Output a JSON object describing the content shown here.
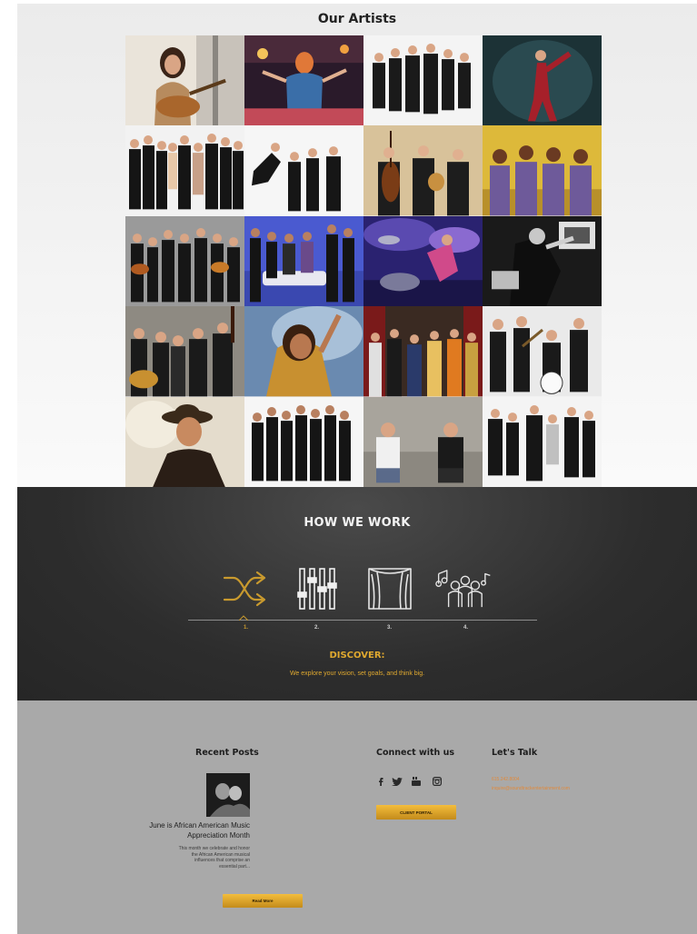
{
  "artists": {
    "title": "Our Artists",
    "tiles": [
      "artist-tile-1",
      "artist-tile-2",
      "artist-tile-3",
      "artist-tile-4",
      "artist-tile-5",
      "artist-tile-6",
      "artist-tile-7",
      "artist-tile-8",
      "artist-tile-9",
      "artist-tile-10",
      "artist-tile-11",
      "artist-tile-12",
      "artist-tile-13",
      "artist-tile-14",
      "artist-tile-15",
      "artist-tile-16",
      "artist-tile-17",
      "artist-tile-18",
      "artist-tile-19",
      "artist-tile-20"
    ]
  },
  "how_we_work": {
    "title": "HOW WE WORK",
    "steps": [
      {
        "number": "1.",
        "icon": "shuffle-icon"
      },
      {
        "number": "2.",
        "icon": "mixer-sliders-icon"
      },
      {
        "number": "3.",
        "icon": "stage-curtain-icon"
      },
      {
        "number": "4.",
        "icon": "audience-music-icon"
      }
    ],
    "active_step_title": "DISCOVER:",
    "active_step_text": "We explore your vision, set goals, and think big."
  },
  "footer": {
    "recent_posts": {
      "heading": "Recent Posts",
      "post_title": "June is African American Music Appreciation Month",
      "post_excerpt": "This month we celebrate and honor the African American musical influences that comprise an essential part...",
      "read_more": "Read More"
    },
    "connect": {
      "heading": "Connect with us",
      "icons": [
        "facebook-icon",
        "twitter-icon",
        "youtube-icon",
        "instagram-icon"
      ],
      "portal_button": "CLIENT PORTAL"
    },
    "talk": {
      "heading": "Let's Talk",
      "phone": "615.242.8004",
      "email": "inquire@soundtrackentertainment.com"
    }
  },
  "colors": {
    "accent": "#e0a92f",
    "dark_band": "#2d2d2d",
    "footer_bg": "#a9a9a9",
    "contact_link": "#e08a3c"
  }
}
